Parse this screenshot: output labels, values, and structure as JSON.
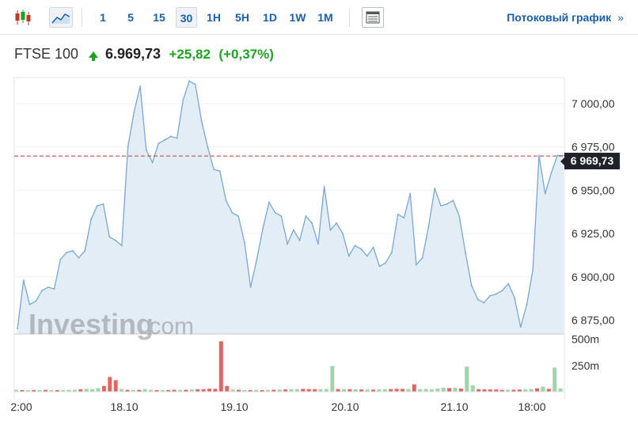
{
  "toolbar": {
    "chart_type_candle_icon": "candlestick-icon",
    "chart_type_area_icon": "area-chart-icon",
    "intervals": [
      "1",
      "5",
      "15",
      "30",
      "1H",
      "5H",
      "1D",
      "1W",
      "1M"
    ],
    "active_interval": "30",
    "table_icon": "table-icon",
    "stream_label": "Потоковый график",
    "stream_chevron": "»"
  },
  "quote": {
    "name": "FTSE 100",
    "last": "6.969,73",
    "change": "+25,82",
    "change_pct": "(+0,37%)",
    "direction_icon": "arrow-up-icon",
    "up_color": "#21a121"
  },
  "watermark": {
    "brand": "Investing",
    "suffix": ".com"
  },
  "current_price_label": "6 969,73",
  "chart_data": {
    "type": "area",
    "title": "",
    "x_ticks": [
      "2:00",
      "18.10",
      "19.10",
      "20.10",
      "21.10",
      "18:00"
    ],
    "y_ticks": [
      "7 000,00",
      "6 975,00",
      "6 950,00",
      "6 925,00",
      "6 900,00",
      "6 875,00"
    ],
    "y_tick_values": [
      7000,
      6975,
      6950,
      6925,
      6900,
      6875
    ],
    "ylim": [
      6867,
      7015
    ],
    "current_price": 6969.73,
    "colors": {
      "line": "#7aa7d1",
      "fill": "#e3edf6",
      "vol_up": "#9fd4ab",
      "vol_down": "#e06666",
      "ref_line": "#c0392b"
    },
    "series": [
      {
        "values": [
          6870,
          6898,
          6884,
          6886,
          6892,
          6894,
          6893,
          6910,
          6914,
          6915,
          6911,
          6915,
          6933,
          6941,
          6942,
          6923,
          6921,
          6918,
          6975,
          6995,
          7010,
          6973,
          6966,
          6977,
          6979,
          6981,
          6980,
          7002,
          7013,
          7011,
          6990,
          6975,
          6962,
          6961,
          6944,
          6937,
          6935,
          6920,
          6894,
          6910,
          6928,
          6943,
          6937,
          6935,
          6919,
          6927,
          6921,
          6935,
          6931,
          6919,
          6952,
          6927,
          6931,
          6925,
          6912,
          6918,
          6916,
          6912,
          6917,
          6906,
          6908,
          6914,
          6936,
          6934,
          6948,
          6907,
          6911,
          6929,
          6951,
          6941,
          6942,
          6944,
          6935,
          6914,
          6895,
          6887,
          6885,
          6889,
          6890,
          6892,
          6896,
          6888,
          6871,
          6884,
          6904,
          6970,
          6948,
          6960,
          6970,
          6970
        ]
      }
    ],
    "volume": {
      "ticks": [
        "500m",
        "250m"
      ],
      "tick_values": [
        500,
        250
      ],
      "ylim": [
        0,
        520
      ],
      "values": [
        19,
        16,
        13,
        16,
        14,
        18,
        12,
        12,
        15,
        17,
        19,
        23,
        27,
        25,
        35,
        55,
        140,
        110,
        26,
        17,
        17,
        18,
        25,
        18,
        14,
        12,
        14,
        18,
        17,
        19,
        22,
        23,
        25,
        29,
        28,
        480,
        55,
        22,
        18,
        16,
        14,
        17,
        16,
        18,
        19,
        21,
        22,
        23,
        25,
        27,
        26,
        25,
        24,
        26,
        245,
        26,
        25,
        24,
        23,
        22,
        21,
        20,
        22,
        24,
        26,
        28,
        27,
        25,
        70,
        23,
        26,
        24,
        30,
        38,
        35,
        37,
        30,
        240,
        60,
        24,
        23,
        22,
        21,
        17,
        18,
        19,
        21,
        23,
        26,
        32,
        49,
        28,
        230,
        32
      ],
      "directions": [
        "u",
        "d",
        "u",
        "d",
        "u",
        "d",
        "u",
        "d",
        "u",
        "u",
        "u",
        "d",
        "u",
        "u",
        "u",
        "d",
        "d",
        "d",
        "u",
        "d",
        "u",
        "d",
        "u",
        "u",
        "d",
        "u",
        "d",
        "d",
        "u",
        "d",
        "u",
        "d",
        "d",
        "d",
        "d",
        "d",
        "d",
        "u",
        "d",
        "u",
        "d",
        "u",
        "d",
        "u",
        "d",
        "u",
        "d",
        "u",
        "u",
        "d",
        "d",
        "d",
        "u",
        "u",
        "u",
        "d",
        "u",
        "d",
        "u",
        "d",
        "u",
        "d",
        "u",
        "u",
        "d",
        "d",
        "d",
        "u",
        "d",
        "u",
        "u",
        "u",
        "u",
        "u",
        "d",
        "u",
        "d",
        "u",
        "u",
        "d",
        "d",
        "d",
        "d",
        "d",
        "u",
        "d",
        "d",
        "u",
        "u",
        "d",
        "u",
        "d",
        "u",
        "u"
      ]
    }
  }
}
